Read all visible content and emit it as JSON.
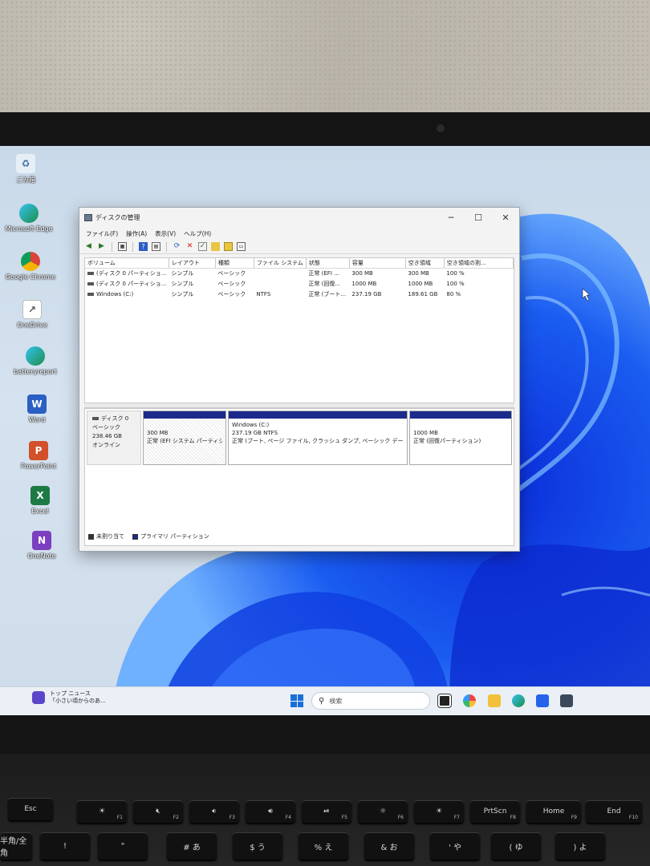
{
  "window": {
    "title": "ディスクの管理",
    "controls": {
      "minimize": "─",
      "maximize": "☐",
      "close": "✕"
    },
    "menu": [
      "ファイル(F)",
      "操作(A)",
      "表示(V)",
      "ヘルプ(H)"
    ],
    "toolbar_icons": [
      "back-arrow",
      "forward-arrow",
      "grid-view",
      "help-book",
      "properties",
      "rescan",
      "delete",
      "checkmark",
      "new-volume",
      "open",
      "console"
    ]
  },
  "volume_table": {
    "headers": [
      "ボリューム",
      "レイアウト",
      "種類",
      "ファイル システム",
      "状態",
      "容量",
      "空き領域",
      "空き領域の割..."
    ],
    "rows": [
      [
        "(ディスク 0 パーティショ...",
        "シンプル",
        "ベーシック",
        "",
        "正常 (EFI ...",
        "300 MB",
        "300 MB",
        "100 %"
      ],
      [
        "(ディスク 0 パーティショ...",
        "シンプル",
        "ベーシック",
        "",
        "正常 (回復...",
        "1000 MB",
        "1000 MB",
        "100 %"
      ],
      [
        "Windows (C:)",
        "シンプル",
        "ベーシック",
        "NTFS",
        "正常 (ブート...",
        "237.19 GB",
        "189.61 GB",
        "80 %"
      ]
    ]
  },
  "disk": {
    "name": "ディスク 0",
    "type": "ベーシック",
    "size": "238.46 GB",
    "status": "オンライン",
    "partitions": [
      {
        "name": "",
        "size": "300 MB",
        "status": "正常 (EFI システム パーティシ"
      },
      {
        "name": "Windows  (C:)",
        "size": "237.19 GB NTFS",
        "status": "正常 (ブート, ページ ファイル, クラッシュ ダンプ, ベーシック データ パーテ"
      },
      {
        "name": "",
        "size": "1000 MB",
        "status": "正常 (回復パーティション)"
      }
    ]
  },
  "legend": {
    "unallocated": "未割り当て",
    "primary": "プライマリ パーティション",
    "unallocated_color": "#333333",
    "primary_color": "#1c2a8c"
  },
  "desktop_icons": [
    {
      "label": "ごみ箱",
      "icon": "recycle-bin-icon"
    },
    {
      "label": "Microsoft Edge",
      "icon": "edge-icon"
    },
    {
      "label": "Google Chrome",
      "icon": "chrome-icon"
    },
    {
      "label": "OneDrive",
      "icon": "onedrive-icon"
    },
    {
      "label": "batteryreport",
      "icon": "edge-icon"
    },
    {
      "label": "Word",
      "icon": "word-icon"
    },
    {
      "label": "PowerPoint",
      "icon": "powerpoint-icon"
    },
    {
      "label": "Excel",
      "icon": "excel-icon"
    },
    {
      "label": "OneNote",
      "icon": "onenote-icon"
    }
  ],
  "taskbar": {
    "news_title": "トップ ニュース",
    "news_sub": "「小さい頃からのあ...",
    "search_placeholder": "検索"
  },
  "keyboard": {
    "esc": "Esc",
    "f_keys": [
      "F1",
      "F2",
      "F3",
      "F4",
      "F5",
      "F6",
      "F7",
      "F8",
      "F9",
      "F10"
    ],
    "prtscn": "PrtScn",
    "home": "Home",
    "end": "End",
    "row2": [
      "半角/全角",
      "!",
      "\"",
      "#  あ",
      "$  う",
      "%  え",
      "&  お",
      "'  や",
      "(  ゆ",
      ")  よ"
    ]
  }
}
